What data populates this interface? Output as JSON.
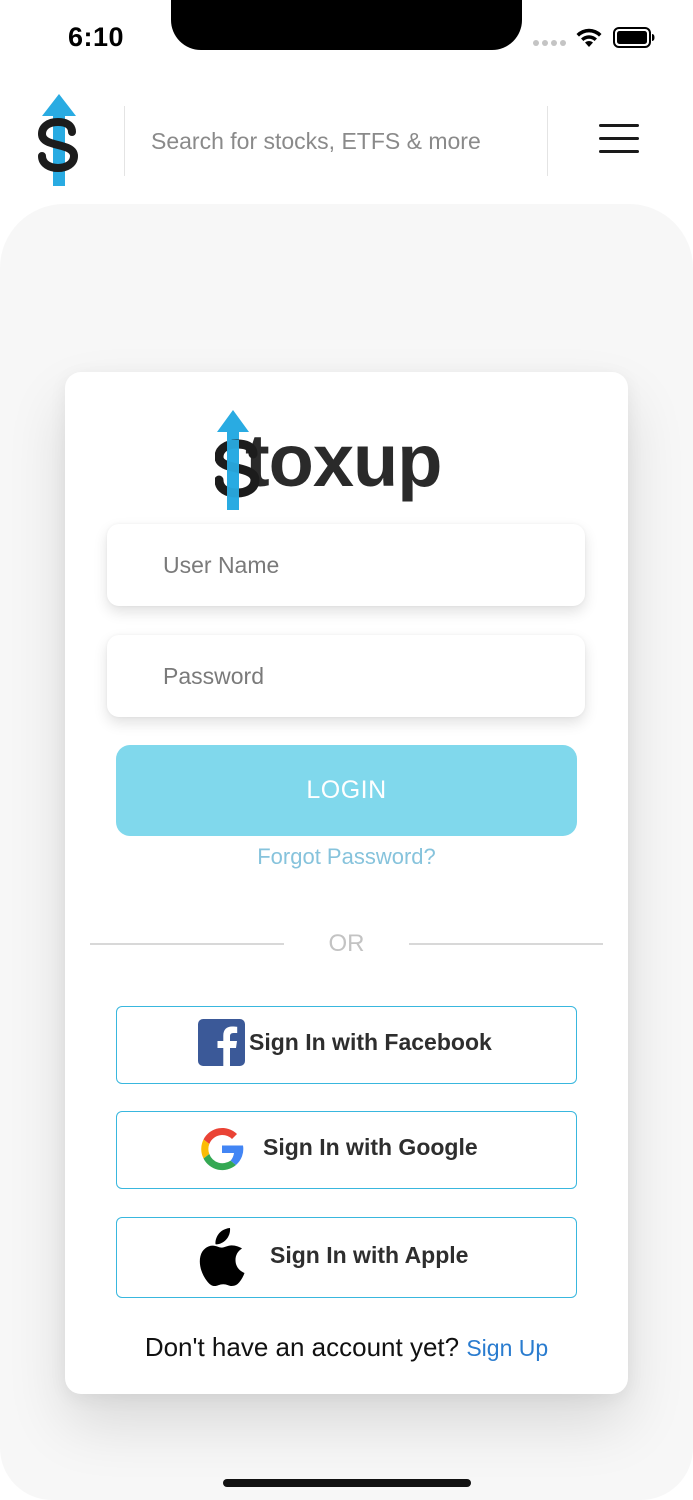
{
  "status_bar": {
    "time": "6:10"
  },
  "header": {
    "search_placeholder": "Search for stocks, ETFS & more"
  },
  "login_card": {
    "logo_text": "toxup",
    "username_placeholder": "User Name",
    "password_placeholder": "Password",
    "login_label": "LOGIN",
    "forgot_label": "Forgot Password?",
    "or_label": "OR",
    "facebook_label": "Sign In with Facebook",
    "google_label": "Sign In with Google",
    "apple_label": "Sign In with Apple",
    "no_account_text": "Don't have an account yet?",
    "signup_label": "Sign Up"
  },
  "colors": {
    "accent": "#80d8ec",
    "brand_blue": "#29abe2",
    "link_blue": "#2a7ccf",
    "social_border": "#39b7de",
    "facebook": "#3b5998",
    "background_gray": "#f7f7f7"
  },
  "icons": [
    "brand-dollar-arrow-icon",
    "hamburger-menu-icon",
    "facebook-icon",
    "google-icon",
    "apple-icon",
    "wifi-icon",
    "battery-icon",
    "signal-icon"
  ]
}
